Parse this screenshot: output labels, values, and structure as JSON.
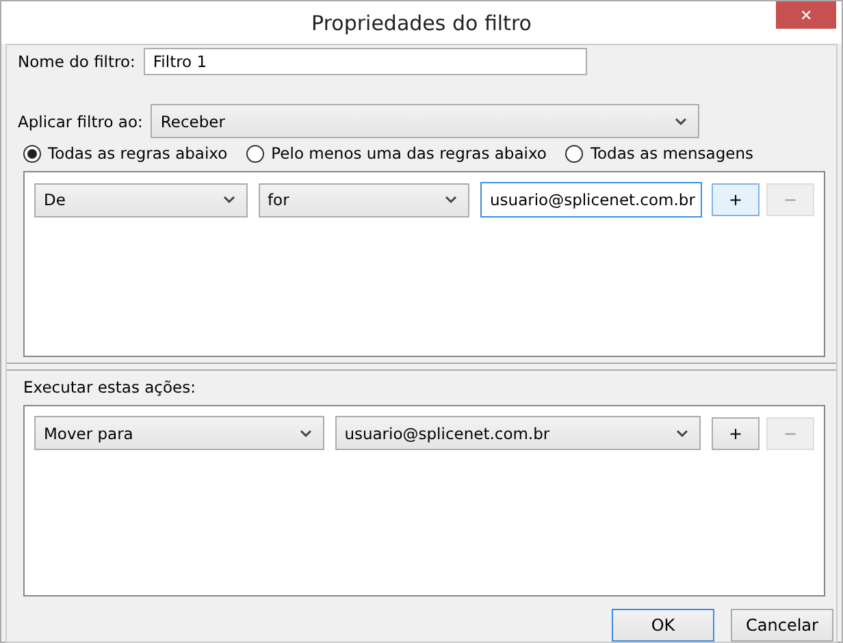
{
  "window": {
    "title": "Propriedades do filtro",
    "close": "✕"
  },
  "filter_name": {
    "label": "Nome do filtro:",
    "value": "Filtro 1"
  },
  "apply_to": {
    "label": "Aplicar filtro ao:",
    "value": "Receber"
  },
  "match_options": [
    {
      "label": "Todas as regras abaixo",
      "selected": true
    },
    {
      "label": "Pelo menos uma das regras abaixo",
      "selected": false
    },
    {
      "label": "Todas as mensagens",
      "selected": false
    }
  ],
  "conditions": [
    {
      "field": "De",
      "operator": "for",
      "value": "usuario@splicenet.com.br",
      "focused": true,
      "buttons": [
        {
          "label": "+",
          "disabled": false,
          "hover": true
        },
        {
          "label": "−",
          "disabled": true,
          "hover": false
        }
      ]
    }
  ],
  "actions_label": "Executar estas ações:",
  "actions": [
    {
      "action": "Mover para",
      "target": "usuario@splicenet.com.br",
      "buttons": [
        {
          "label": "+",
          "disabled": false,
          "hover": false
        },
        {
          "label": "−",
          "disabled": true,
          "hover": false
        }
      ]
    }
  ],
  "footer_buttons": [
    {
      "label": "OK",
      "default": true
    },
    {
      "label": "Cancelar",
      "default": false
    }
  ]
}
